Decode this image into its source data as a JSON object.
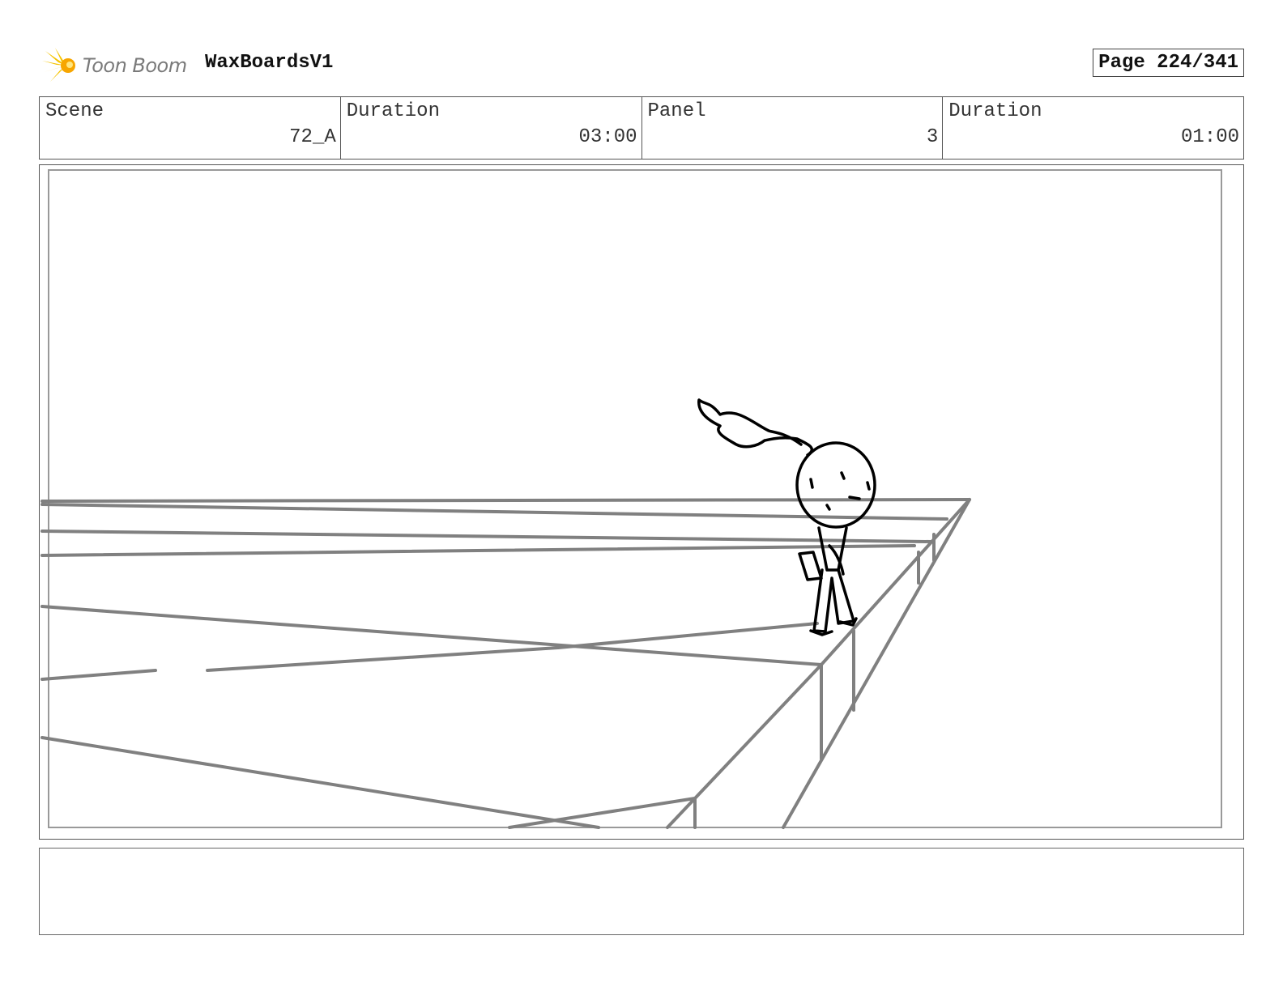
{
  "header": {
    "logo_text": "Toon Boom",
    "project_title": "WaxBoardsV1",
    "page_label": "Page 224/341"
  },
  "info": {
    "scene_label": "Scene",
    "scene_value": "72_A",
    "scene_duration_label": "Duration",
    "scene_duration_value": "03:00",
    "panel_label": "Panel",
    "panel_value": "3",
    "panel_duration_label": "Duration",
    "panel_duration_value": "01:00"
  },
  "notes": {
    "text": ""
  },
  "colors": {
    "ink": "#000000",
    "set_lines": "#808080",
    "frame": "#555555",
    "logo_accent": "#f5c400"
  }
}
